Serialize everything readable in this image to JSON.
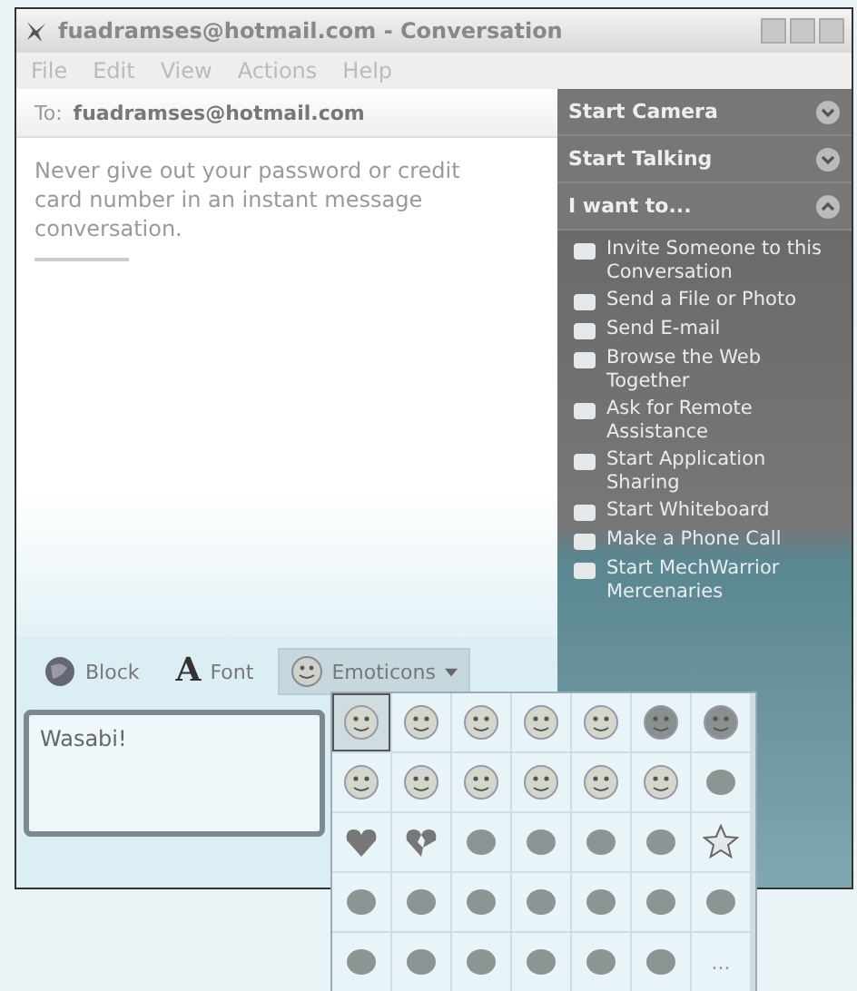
{
  "window": {
    "title": "fuadramses@hotmail.com - Conversation"
  },
  "menu": [
    "File",
    "Edit",
    "View",
    "Actions",
    "Help"
  ],
  "to": {
    "label": "To:",
    "address": "fuadramses@hotmail.com"
  },
  "notice": "Never give out your password or credit card number in an instant message conversation.",
  "side_sections": [
    {
      "label": "Start Camera",
      "expanded": false
    },
    {
      "label": "Start Talking",
      "expanded": false
    },
    {
      "label": "I want to...",
      "expanded": true
    }
  ],
  "actions": [
    {
      "label": "Invite Someone to this Conversation"
    },
    {
      "label": "Send a File or Photo"
    },
    {
      "label": "Send E-mail"
    },
    {
      "label": "Browse the Web Together"
    },
    {
      "label": "Ask for Remote Assistance"
    },
    {
      "label": "Start Application Sharing"
    },
    {
      "label": "Start Whiteboard"
    },
    {
      "label": "Make a Phone Call"
    },
    {
      "label": "Start MechWarrior Mercenaries"
    }
  ],
  "toolbar": [
    {
      "label": "Block",
      "pressed": false
    },
    {
      "label": "Font",
      "pressed": false,
      "icon_glyph": "A"
    },
    {
      "label": "Emoticons",
      "pressed": true
    }
  ],
  "message": "Wasabi!",
  "emoticons": [
    {
      "selected": true
    },
    {
      "selected": false
    },
    {
      "selected": false
    },
    {
      "selected": false
    },
    {
      "selected": false
    },
    {
      "selected": false
    },
    {
      "selected": false
    },
    {
      "selected": false
    },
    {
      "selected": false
    },
    {
      "selected": false
    },
    {
      "selected": false
    },
    {
      "selected": false
    },
    {
      "selected": false
    },
    {
      "selected": false
    },
    {
      "selected": false
    },
    {
      "selected": false
    },
    {
      "selected": false
    },
    {
      "selected": false
    },
    {
      "selected": false
    },
    {
      "selected": false
    },
    {
      "selected": false
    },
    {
      "selected": false
    },
    {
      "selected": false
    },
    {
      "selected": false
    },
    {
      "selected": false
    },
    {
      "selected": false
    },
    {
      "selected": false
    },
    {
      "selected": false
    },
    {
      "selected": false
    },
    {
      "selected": false
    },
    {
      "selected": false
    },
    {
      "selected": false
    },
    {
      "selected": false
    },
    {
      "selected": false
    }
  ],
  "more_emoticons": "..."
}
